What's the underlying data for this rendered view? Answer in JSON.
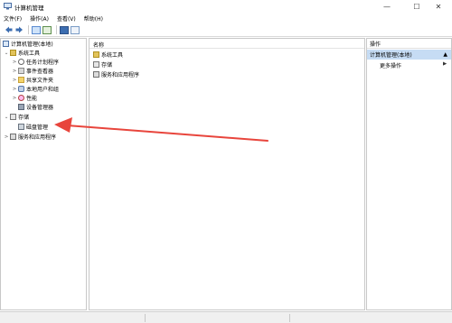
{
  "window": {
    "title": "计算机管理",
    "controls": {
      "minimize": "—",
      "maximize": "☐",
      "close": "✕"
    }
  },
  "menubar": {
    "items": [
      "文件(F)",
      "操作(A)",
      "查看(V)",
      "帮助(H)"
    ]
  },
  "toolbar": {
    "icons": [
      "back-arrow-icon",
      "forward-arrow-icon",
      "show-hide-console-tree-icon",
      "export-list-icon",
      "help-icon",
      "properties-icon"
    ]
  },
  "tree": {
    "root": "计算机管理(本地)",
    "items": [
      {
        "label": "系统工具",
        "level": 1,
        "expander": "⌄",
        "icon": "tools-icon"
      },
      {
        "label": "任务计划程序",
        "level": 2,
        "expander": ">",
        "icon": "clock-icon"
      },
      {
        "label": "事件查看器",
        "level": 2,
        "expander": ">",
        "icon": "event-log-icon"
      },
      {
        "label": "共享文件夹",
        "level": 2,
        "expander": ">",
        "icon": "shared-folder-icon"
      },
      {
        "label": "本地用户和组",
        "level": 2,
        "expander": ">",
        "icon": "users-icon"
      },
      {
        "label": "性能",
        "level": 2,
        "expander": ">",
        "icon": "performance-icon"
      },
      {
        "label": "设备管理器",
        "level": 2,
        "expander": "",
        "icon": "device-manager-icon"
      },
      {
        "label": "存储",
        "level": 1,
        "expander": "⌄",
        "icon": "storage-icon"
      },
      {
        "label": "磁盘管理",
        "level": 2,
        "expander": "",
        "icon": "disk-icon"
      },
      {
        "label": "服务和应用程序",
        "level": 1,
        "expander": ">",
        "icon": "services-icon"
      }
    ]
  },
  "list": {
    "column": "名称",
    "rows": [
      "系统工具",
      "存储",
      "服务和应用程序"
    ]
  },
  "actions": {
    "header": "操作",
    "section": "计算机管理(本地)",
    "section_arrow": "▲",
    "more": "更多操作",
    "more_arrow": "▶"
  },
  "colors": {
    "accent": "#c6dcf4",
    "annotation_arrow": "#e8453c"
  }
}
